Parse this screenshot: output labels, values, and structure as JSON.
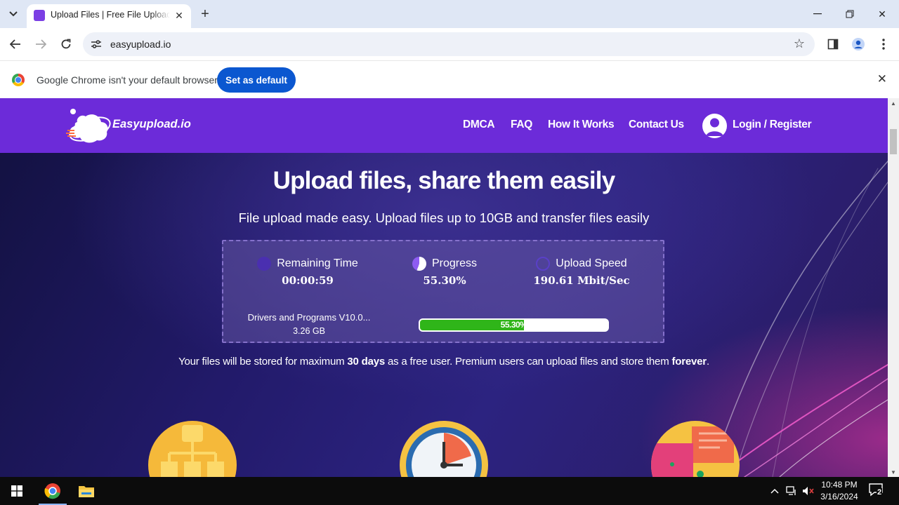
{
  "browser": {
    "tab": {
      "title": "Upload Files | Free File Upload"
    },
    "address_bar": {
      "url": "easyupload.io"
    },
    "infobar": {
      "message": "Google Chrome isn't your default browser",
      "button_label": "Set as default"
    }
  },
  "site": {
    "logo_text": "Easyupload.io",
    "nav": [
      {
        "label": "DMCA"
      },
      {
        "label": "FAQ"
      },
      {
        "label": "How It Works"
      },
      {
        "label": "Contact Us"
      }
    ],
    "login_label": "Login / Register",
    "hero": {
      "title": "Upload files, share them easily",
      "subtitle": "File upload made easy. Upload files up to 10GB and transfer files easily"
    },
    "upload": {
      "remaining_label": "Remaining Time",
      "remaining_value": "00:00:59",
      "progress_label": "Progress",
      "progress_value": "55.30%",
      "speed_label": "Upload Speed",
      "speed_value": "190.61 Mbit/Sec",
      "file_name": "Drivers and Programs V10.0...",
      "file_size": "3.26 GB",
      "progress_fraction": 0.553,
      "progress_bar_text": "55.30%"
    },
    "storage_note": {
      "prefix": "Your files will be stored for maximum ",
      "days": "30 days",
      "middle": " as a free user. Premium users can upload files and store them ",
      "forever": "forever",
      "suffix": "."
    }
  },
  "taskbar": {
    "time": "10:48 PM",
    "date": "3/16/2024",
    "notification_count": "2"
  },
  "colors": {
    "header_purple": "#6c2bd9",
    "progress_green": "#2fb519",
    "chrome_blue": "#0b57d0"
  }
}
